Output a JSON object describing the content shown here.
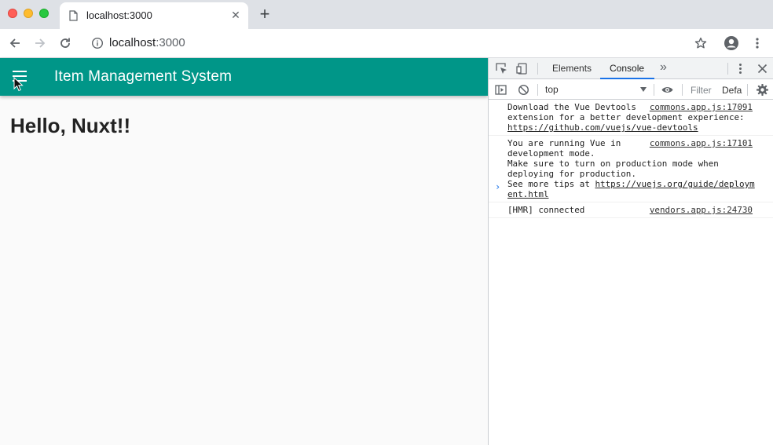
{
  "browser": {
    "tab_title": "localhost:3000",
    "new_tab_label": "+",
    "url_host": "localhost",
    "url_port": ":3000"
  },
  "app": {
    "title": "Item Management System",
    "heading": "Hello, Nuxt!!",
    "accent_color": "#009688"
  },
  "devtools": {
    "tabs": [
      {
        "label": "Elements",
        "active": false
      },
      {
        "label": "Console",
        "active": true
      }
    ],
    "more_tabs": "»",
    "context": "top",
    "filter_placeholder": "Filter",
    "levels_label": "Defa",
    "messages": [
      {
        "source": "commons.app.js:17091",
        "lines": [
          "Download the Vue Devtools",
          "extension for a better development experience:"
        ],
        "link": "https://github.com/vuejs/vue-devtools"
      },
      {
        "source": "commons.app.js:17101",
        "lines": [
          "You are running Vue in",
          "development mode.",
          "Make sure to turn on production mode when",
          "deploying for production."
        ],
        "tail_prefix": "See more tips at ",
        "link_part1": "https://vuejs.org/guide/deploym",
        "link_part2": "ent.html"
      },
      {
        "source": "vendors.app.js:24730",
        "lines": [
          "[HMR] connected"
        ]
      }
    ],
    "prompt": "›"
  }
}
